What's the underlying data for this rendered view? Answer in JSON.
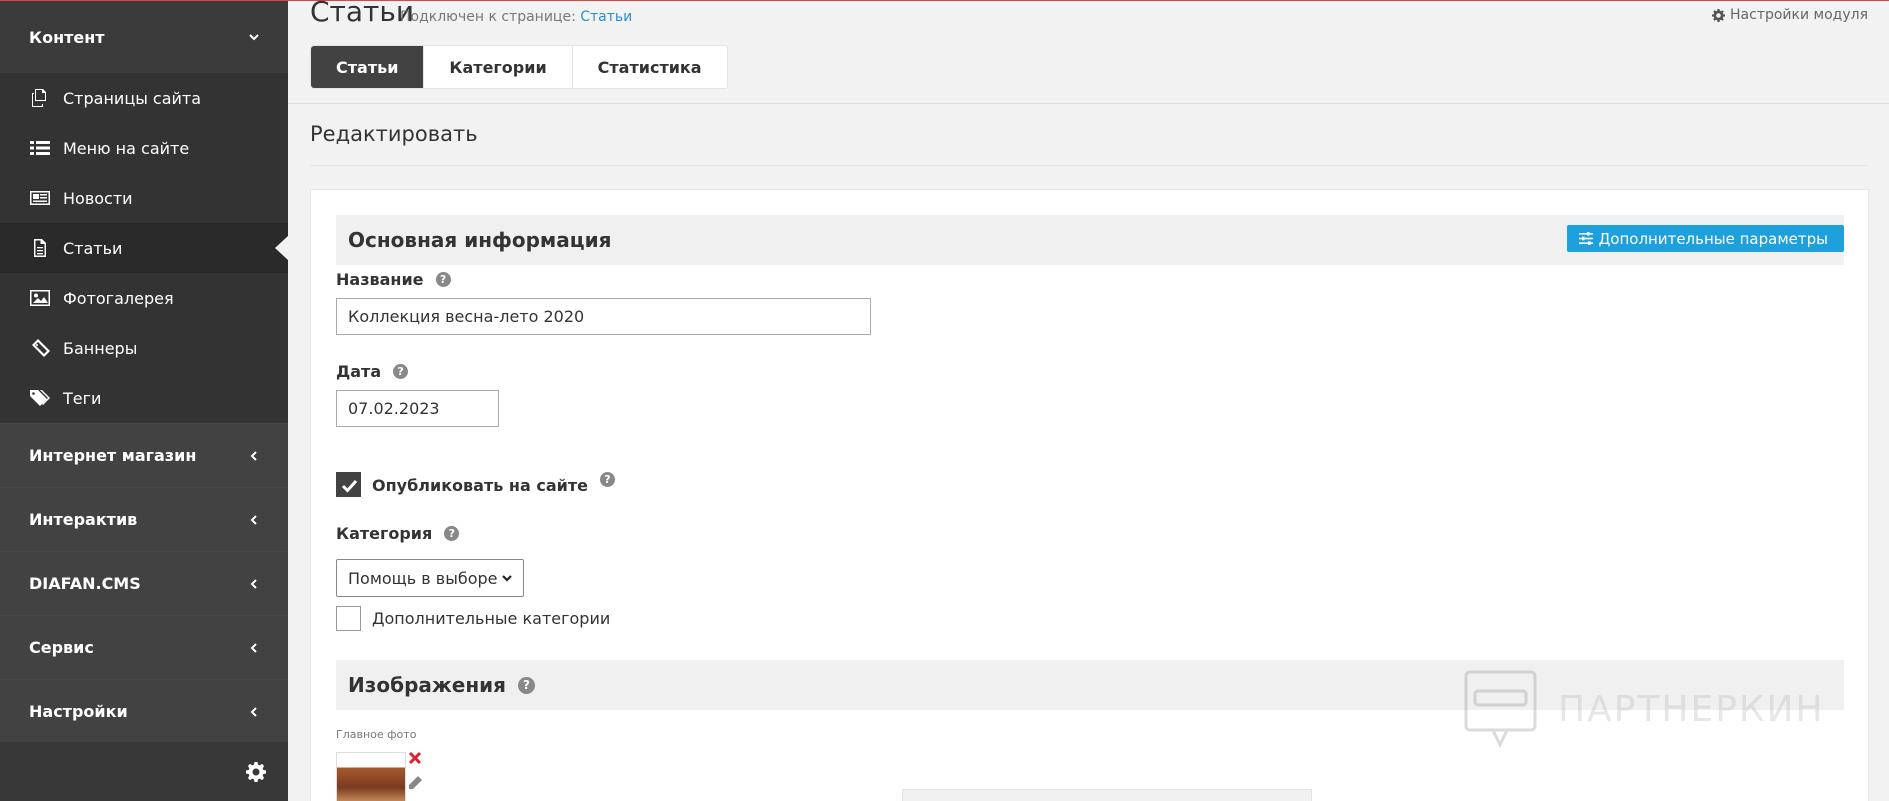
{
  "sidebar": {
    "content_section": "Контент",
    "items": [
      {
        "label": "Страницы сайта",
        "icon": "pages-icon"
      },
      {
        "label": "Меню на сайте",
        "icon": "list-icon"
      },
      {
        "label": "Новости",
        "icon": "newspaper-icon"
      },
      {
        "label": "Статьи",
        "icon": "document-icon",
        "active": true
      },
      {
        "label": "Фотогалерея",
        "icon": "image-icon"
      },
      {
        "label": "Баннеры",
        "icon": "ticket-icon"
      },
      {
        "label": "Теги",
        "icon": "tags-icon"
      }
    ],
    "sections": [
      "Интернет магазин",
      "Интерактив",
      "DIAFAN.CMS",
      "Сервис",
      "Настройки"
    ]
  },
  "header": {
    "title": "Статьи",
    "linked_prefix": "Подключен к странице:",
    "linked_page": "Статьи",
    "module_settings": "Настройки модуля"
  },
  "tabs": [
    "Статьи",
    "Категории",
    "Статистика"
  ],
  "edit": {
    "title": "Редактировать",
    "section_main": "Основная информация",
    "extra_params": "Дополнительные параметры",
    "name_label": "Название",
    "name_value": "Коллекция весна-лето 2020",
    "date_label": "Дата",
    "date_value": "07.02.2023",
    "publish_label": "Опубликовать на сайте",
    "category_label": "Категория",
    "category_value": "Помощь в выборе",
    "extra_categories_label": "Дополнительные категории",
    "section_images": "Изображения",
    "main_photo_label": "Главное фото"
  },
  "watermark": "ПАРТНЕРКИН",
  "colors": {
    "sidebar": "#424242",
    "accent": "#1ea0dc",
    "link": "#2a8ec9"
  }
}
